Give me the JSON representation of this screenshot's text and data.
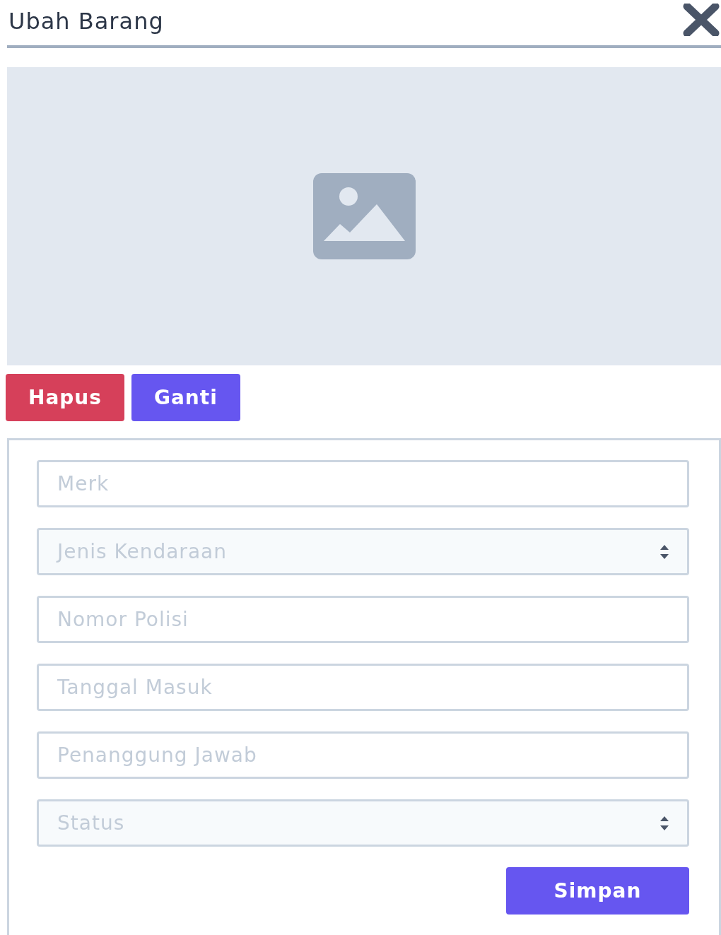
{
  "dialog": {
    "title": "Ubah Barang"
  },
  "image_actions": [
    {
      "label": "Hapus",
      "kind": "danger"
    },
    {
      "label": "Ganti",
      "kind": "primary"
    }
  ],
  "form": {
    "fields": [
      {
        "kind": "text",
        "placeholder": "Merk"
      },
      {
        "kind": "select",
        "placeholder": "Jenis Kendaraan"
      },
      {
        "kind": "text",
        "placeholder": "Nomor Polisi"
      },
      {
        "kind": "text",
        "placeholder": "Tanggal Masuk"
      },
      {
        "kind": "text",
        "placeholder": "Penanggung Jawab"
      },
      {
        "kind": "select",
        "placeholder": "Status"
      }
    ],
    "submit": "Simpan"
  }
}
